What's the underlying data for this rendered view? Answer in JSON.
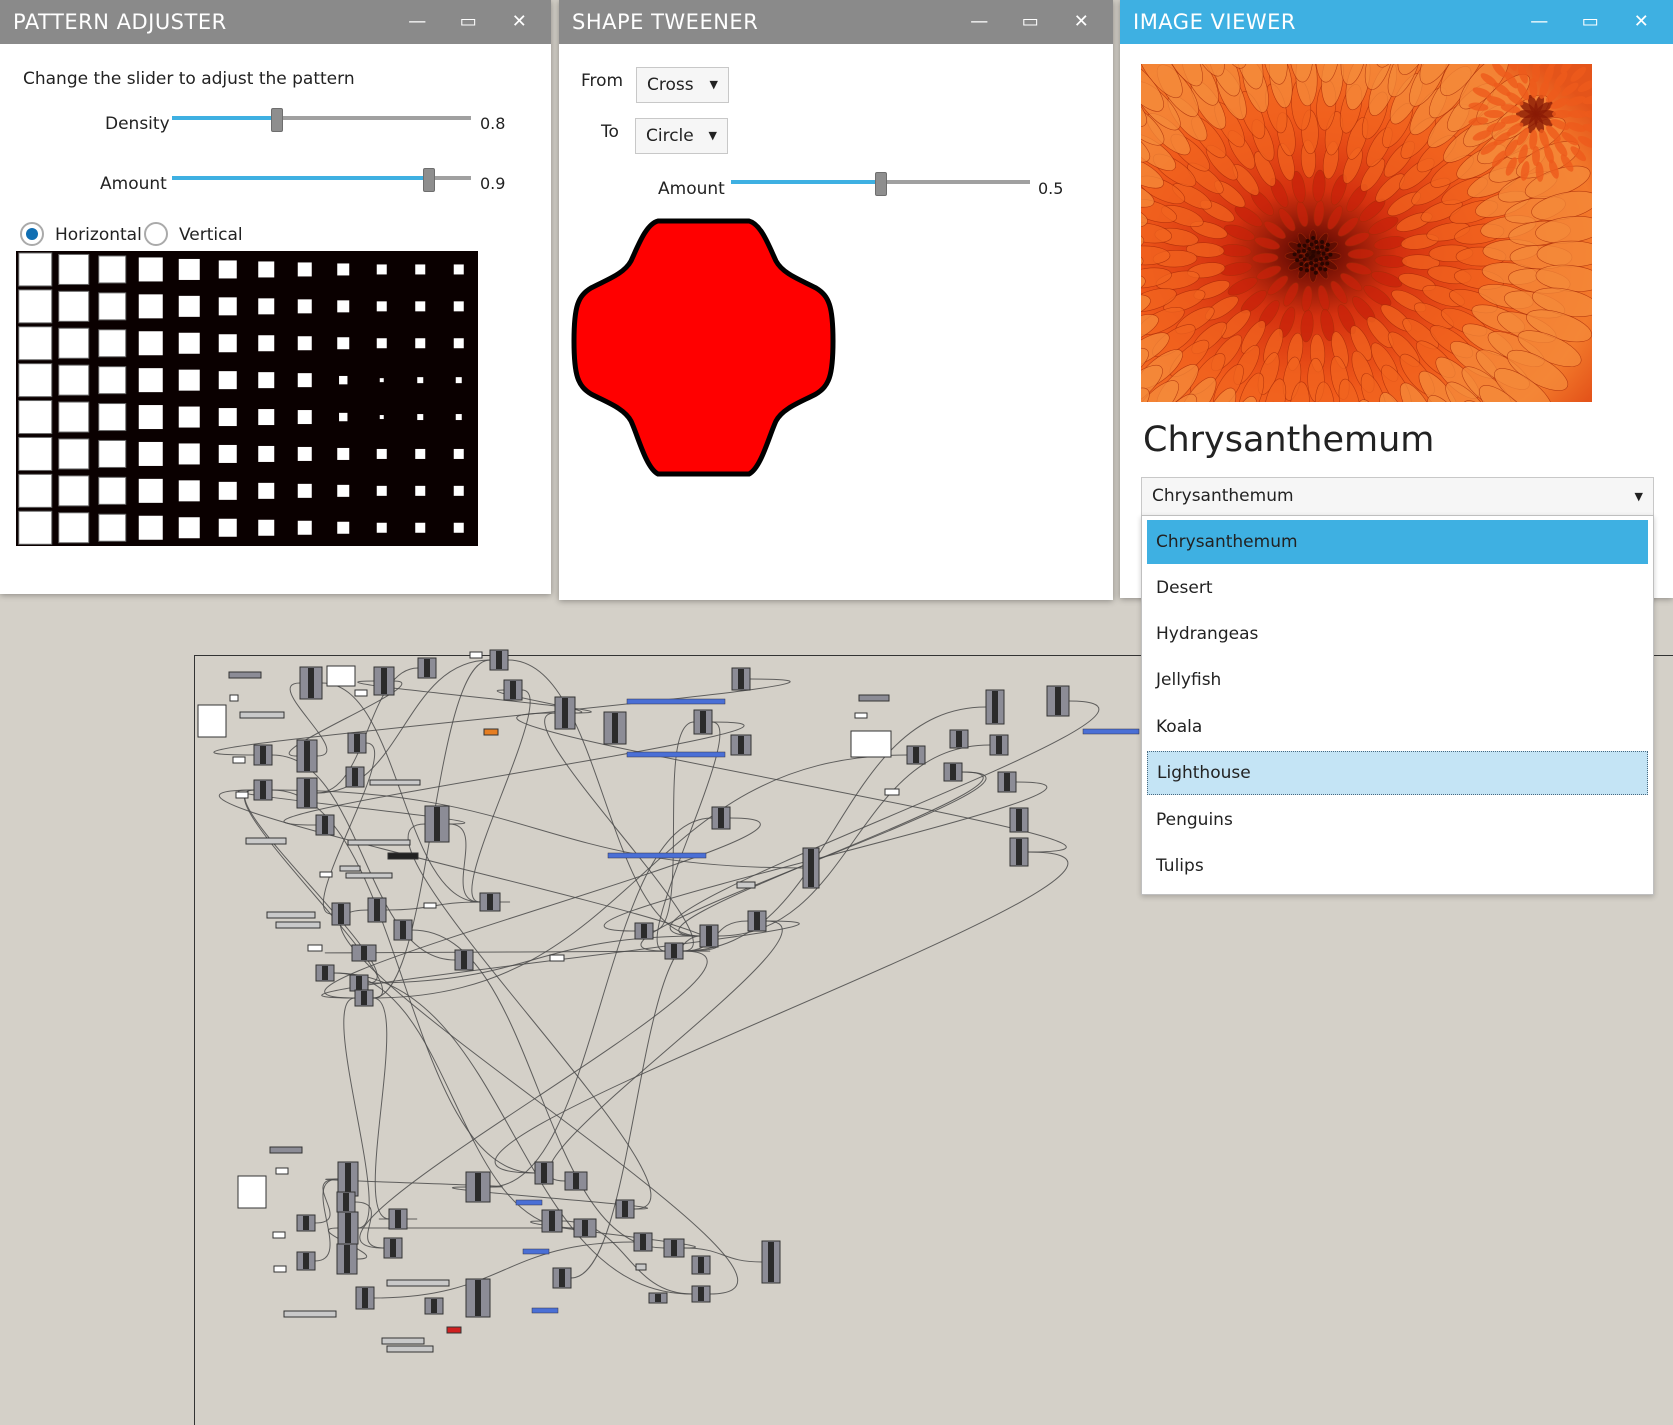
{
  "pattern_adjuster": {
    "title": "PATTERN ADJUSTER",
    "instruction": "Change the slider to adjust the pattern",
    "density": {
      "label": "Density",
      "value": "0.8",
      "fraction": 0.35
    },
    "amount": {
      "label": "Amount",
      "value": "0.9",
      "fraction": 0.86
    },
    "orientation": {
      "horizontal_label": "Horizontal",
      "vertical_label": "Vertical",
      "selected": "Horizontal"
    }
  },
  "shape_tweener": {
    "title": "SHAPE TWEENER",
    "from_label": "From",
    "from_value": "Cross",
    "to_label": "To",
    "to_value": "Circle",
    "amount": {
      "label": "Amount",
      "value": "0.5",
      "fraction": 0.5
    },
    "shape_fill": "#ff0000"
  },
  "image_viewer": {
    "title": "IMAGE VIEWER",
    "image_name": "Chrysanthemum",
    "selected": "Chrysanthemum",
    "options": [
      "Chrysanthemum",
      "Desert",
      "Hydrangeas",
      "Jellyfish",
      "Koala",
      "Lighthouse",
      "Penguins",
      "Tulips"
    ],
    "hovered": "Lighthouse"
  },
  "window_controls": {
    "minimize_icon": "minimize-icon",
    "maximize_icon": "maximize-icon",
    "close_icon": "close-icon"
  },
  "colors": {
    "accent": "#3eb0e2",
    "titlebar_inactive": "#8a8a8a",
    "canvas": "#d4d0c8",
    "wire_blue": "#4a6fd6"
  }
}
